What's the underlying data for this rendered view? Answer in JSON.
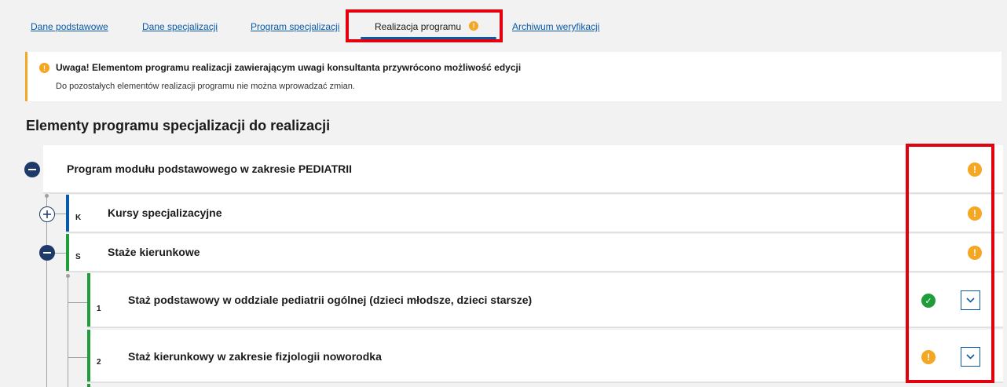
{
  "tabs": [
    {
      "label": "Dane podstawowe"
    },
    {
      "label": "Dane specjalizacji"
    },
    {
      "label": "Program specjalizacji"
    },
    {
      "label": "Realizacja programu",
      "active": true,
      "has_warning": true
    },
    {
      "label": "Archiwum weryfikacji"
    }
  ],
  "alert": {
    "title": "Uwaga! Elementom programu realizacji zawierającym uwagi konsultanta przywrócono możliwość edycji",
    "body": "Do pozostałych elementów realizacji programu nie można wprowadzać zmian."
  },
  "section_title": "Elementy programu specjalizacji do realizacji",
  "tree": {
    "root": {
      "label": "Program modułu podstawowego w zakresie PEDIATRII",
      "status": "warning",
      "expanded": true
    },
    "groups": [
      {
        "letter": "K",
        "label": "Kursy specjalizacyjne",
        "status": "warning",
        "expanded": false
      },
      {
        "letter": "S",
        "label": "Staże kierunkowe",
        "status": "warning",
        "expanded": true
      }
    ],
    "items": [
      {
        "number": "1",
        "label": "Staż podstawowy w oddziale pediatrii ogólnej (dzieci młodsze, dzieci starsze)",
        "status": "ok"
      },
      {
        "number": "2",
        "label": "Staż kierunkowy w zakresie fizjologii noworodka",
        "status": "warning"
      }
    ]
  },
  "icons": {
    "warning_glyph": "!",
    "ok_glyph": "✓",
    "warning_color": "#f5a623",
    "ok_color": "#1f9d3a",
    "accent_color": "#0b5aa7",
    "highlight_color": "#e3000f"
  }
}
